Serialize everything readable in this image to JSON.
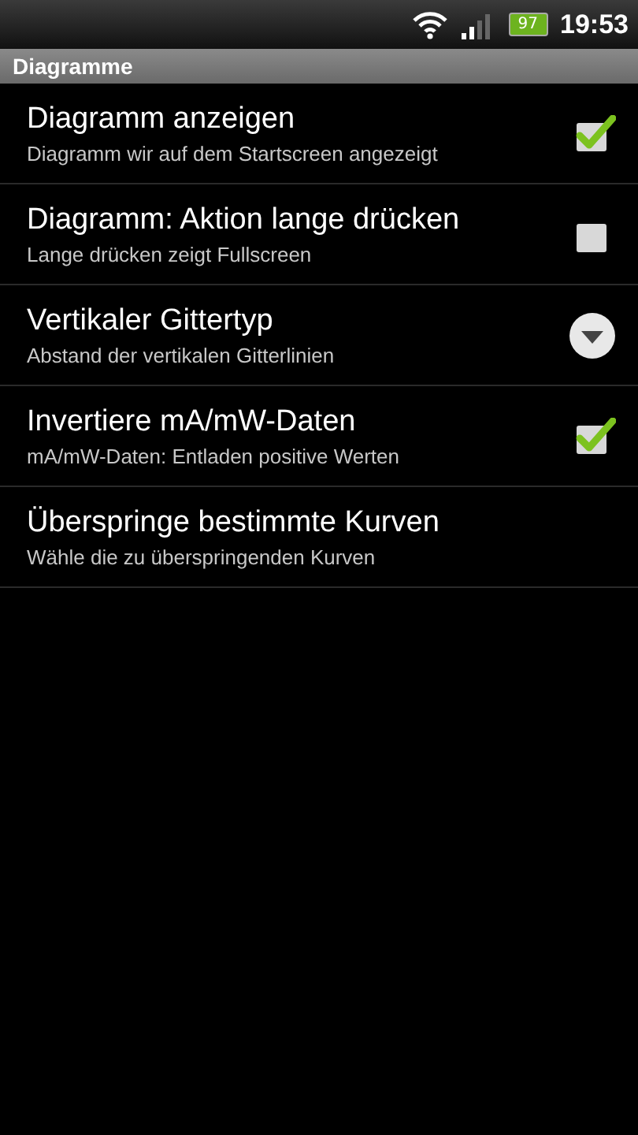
{
  "status_bar": {
    "battery": "97",
    "time": "19:53"
  },
  "section_title": "Diagramme",
  "items": [
    {
      "kind": "checkbox",
      "title": "Diagramm anzeigen",
      "summary": "Diagramm wir auf dem Startscreen angezeigt",
      "checked": true
    },
    {
      "kind": "checkbox",
      "title": "Diagramm: Aktion lange drücken",
      "summary": "Lange drücken zeigt Fullscreen",
      "checked": false
    },
    {
      "kind": "dropdown",
      "title": "Vertikaler Gittertyp",
      "summary": "Abstand der vertikalen Gitterlinien"
    },
    {
      "kind": "checkbox",
      "title": "Invertiere mA/mW-Daten",
      "summary": "mA/mW-Daten: Entladen positive Werten",
      "checked": true
    },
    {
      "kind": "plain",
      "title": "Überspringe bestimmte Kurven",
      "summary": "Wähle die zu überspringenden Kurven"
    }
  ]
}
